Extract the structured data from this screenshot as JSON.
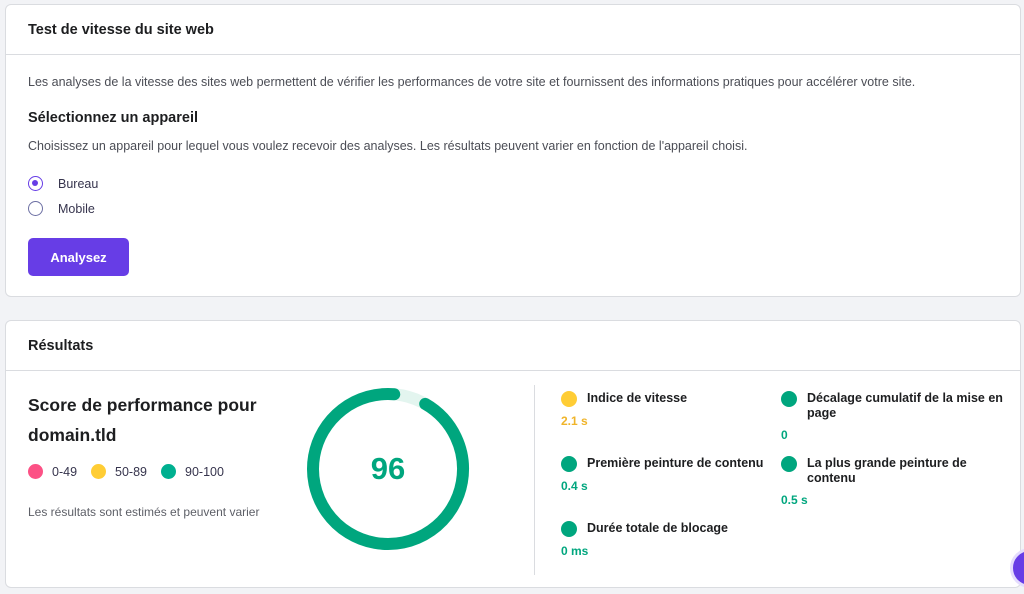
{
  "test_card": {
    "title": "Test de vitesse du site web",
    "intro": "Les analyses de la vitesse des sites web permettent de vérifier les performances de votre site et fournissent des informations pratiques pour accélérer votre site.",
    "device_section": {
      "title": "Sélectionnez un appareil",
      "description": "Choisissez un appareil pour lequel vous voulez recevoir des analyses. Les résultats peuvent varier en fonction de l'appareil choisi.",
      "options": [
        {
          "label": "Bureau",
          "selected": true
        },
        {
          "label": "Mobile",
          "selected": false
        }
      ]
    },
    "analyze_button": "Analysez"
  },
  "results_card": {
    "title": "Résultats",
    "score_title": "Score de performance pour domain.tld",
    "legend": [
      {
        "label": "0-49",
        "color": "#fc5185"
      },
      {
        "label": "50-89",
        "color": "#ffcd35"
      },
      {
        "label": "90-100",
        "color": "#00b090"
      }
    ],
    "note": "Les résultats sont estimés et peuvent varier",
    "score": "96",
    "score_percent": 96,
    "metrics": [
      {
        "label": "Indice de vitesse",
        "value": "2.1 s",
        "status": "average",
        "color": "#ffcd35",
        "value_color": "#f0b429"
      },
      {
        "label": "Décalage cumulatif de la mise en page",
        "value": "0",
        "status": "good",
        "color": "#00a67e",
        "value_color": "#00a67e"
      },
      {
        "label": "Première peinture de contenu",
        "value": "0.4 s",
        "status": "good",
        "color": "#00a67e",
        "value_color": "#00a67e"
      },
      {
        "label": "La plus grande peinture de contenu",
        "value": "0.5 s",
        "status": "good",
        "color": "#00a67e",
        "value_color": "#00a67e"
      },
      {
        "label": "Durée totale de blocage",
        "value": "0 ms",
        "status": "good",
        "color": "#00a67e",
        "value_color": "#00a67e"
      }
    ]
  },
  "colors": {
    "accent": "#673de6",
    "good": "#00a67e",
    "average": "#ffcd35",
    "poor": "#fc5185"
  }
}
